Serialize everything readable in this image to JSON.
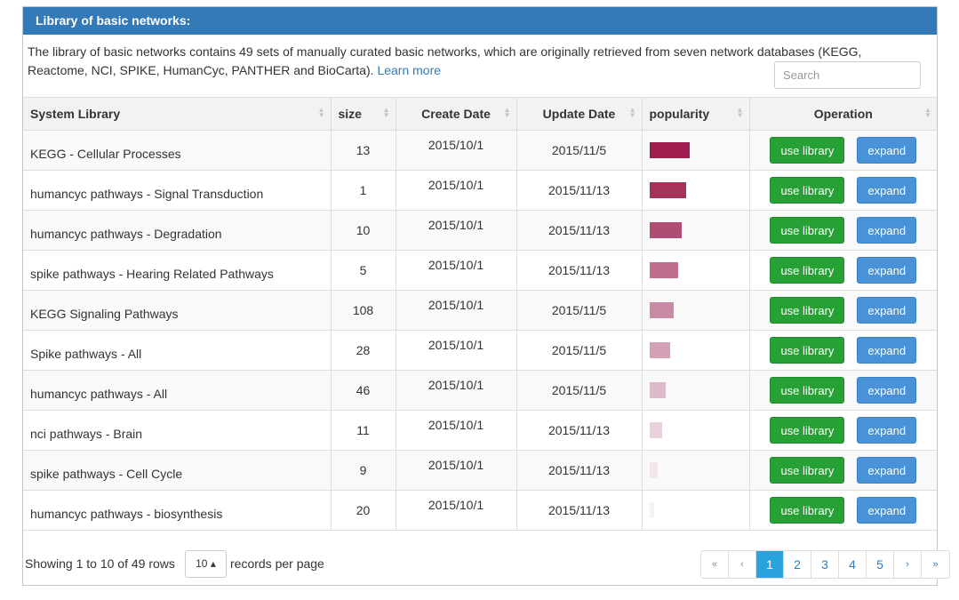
{
  "panel": {
    "title": "Library of basic networks:",
    "description": "The library of basic networks contains 49 sets of manually curated basic networks, which are originally retrieved from seven network databases (KEGG, Reactome, NCI, SPIKE, HumanCyc, PANTHER and BioCarta).",
    "learn_more": "Learn more",
    "search_placeholder": "Search"
  },
  "table": {
    "headers": [
      "System Library",
      "size",
      "Create Date",
      "Update Date",
      "popularity",
      "Operation"
    ],
    "use_label": "use library",
    "expand_label": "expand",
    "rows": [
      {
        "library": "KEGG - Cellular Processes",
        "size": "13",
        "created": "2015/10/1",
        "updated": "2015/11/5",
        "popularity": 1.0,
        "color": "#9e1c4e"
      },
      {
        "library": "humancyc pathways - Signal Transduction",
        "size": "1",
        "created": "2015/10/1",
        "updated": "2015/11/13",
        "popularity": 0.91,
        "color": "#a6325c"
      },
      {
        "library": "humancyc pathways - Degradation",
        "size": "10",
        "created": "2015/10/1",
        "updated": "2015/11/13",
        "popularity": 0.8,
        "color": "#b04d74"
      },
      {
        "library": "spike pathways - Hearing Related Pathways",
        "size": "5",
        "created": "2015/10/1",
        "updated": "2015/11/13",
        "popularity": 0.71,
        "color": "#bf6c8e"
      },
      {
        "library": "KEGG Signaling Pathways",
        "size": "108",
        "created": "2015/10/1",
        "updated": "2015/11/5",
        "popularity": 0.6,
        "color": "#c98aa5"
      },
      {
        "library": "Spike pathways - All",
        "size": "28",
        "created": "2015/10/1",
        "updated": "2015/11/5",
        "popularity": 0.51,
        "color": "#d3a0b6"
      },
      {
        "library": "humancyc pathways - All",
        "size": "46",
        "created": "2015/10/1",
        "updated": "2015/11/5",
        "popularity": 0.4,
        "color": "#ddb9c9"
      },
      {
        "library": "nci pathways - Brain",
        "size": "11",
        "created": "2015/10/1",
        "updated": "2015/11/13",
        "popularity": 0.31,
        "color": "#e8d2dd"
      },
      {
        "library": "spike pathways - Cell Cycle",
        "size": "9",
        "created": "2015/10/1",
        "updated": "2015/11/13",
        "popularity": 0.2,
        "color": "#f0e6ec"
      },
      {
        "library": "humancyc pathways - biosynthesis",
        "size": "20",
        "created": "2015/10/1",
        "updated": "2015/11/13",
        "popularity": 0.11,
        "color": "#f6f1f4"
      }
    ]
  },
  "footer": {
    "showing": "Showing 1 to 10 of 49 rows",
    "page_size": "10",
    "records_per_page": "records per page",
    "pages": [
      "«",
      "‹",
      "1",
      "2",
      "3",
      "4",
      "5",
      "›",
      "»"
    ],
    "active_page": "1"
  }
}
